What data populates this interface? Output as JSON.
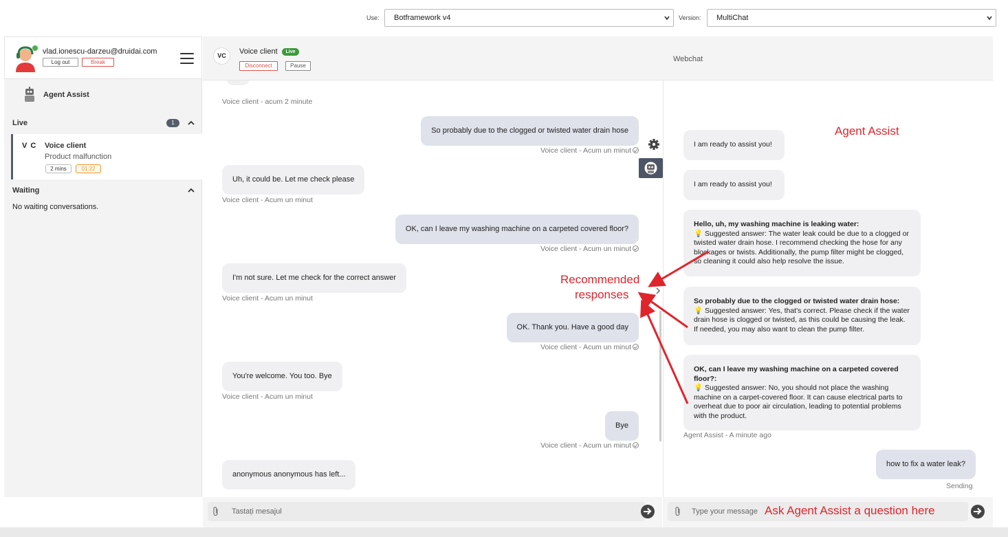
{
  "topbar": {
    "use_label": "Use:",
    "use_value": "Botframework v4",
    "version_label": "Version:",
    "version_value": "MultiChat"
  },
  "agent": {
    "email": "vlad.ionescu-darzeu@druidai.com",
    "logout_label": "Log out",
    "break_label": "Break"
  },
  "sidebar": {
    "agent_assist_label": "Agent Assist",
    "live_label": "Live",
    "live_count": "1",
    "conversation": {
      "initials": "V C",
      "title": "Voice client",
      "subtitle": "Product malfunction",
      "duration": "2 mins",
      "timer": "01:22"
    },
    "waiting_label": "Waiting",
    "no_waiting": "No waiting conversations."
  },
  "header": {
    "initials": "VC",
    "title": "Voice client",
    "live_badge": "Live",
    "disconnect_label": "Disconnect",
    "pause_label": "Pause",
    "webchat_title": "Webchat"
  },
  "chat": {
    "messages": [
      {
        "dir": "in",
        "text": "",
        "meta": "Voice client - acum 2 minute"
      },
      {
        "dir": "out",
        "text": "So probably due to the clogged or twisted water drain hose",
        "meta": "Voice client - Acum un minut"
      },
      {
        "dir": "in",
        "text": "Uh, it could be. Let me check please",
        "meta": "Voice client - Acum un minut"
      },
      {
        "dir": "out",
        "text": "OK, can I leave my washing machine on a carpeted covered floor?",
        "meta": "Voice client - Acum un minut"
      },
      {
        "dir": "in",
        "text": "I'm not sure. Let me check for the correct answer",
        "meta": "Voice client - Acum un minut"
      },
      {
        "dir": "out",
        "text": "OK. Thank you. Have a good day",
        "meta": "Voice client - Acum un minut"
      },
      {
        "dir": "in",
        "text": "You're welcome. You too. Bye",
        "meta": "Voice client - Acum un minut"
      },
      {
        "dir": "out",
        "text": "Bye",
        "meta": "Voice client - Acum un minut"
      },
      {
        "dir": "in",
        "text": "anonymous anonymous has left...",
        "meta": ""
      }
    ],
    "input_placeholder": "Tastați mesajul"
  },
  "assist": {
    "ready1": "I am ready to assist you!",
    "ready2": "I am ready to assist you!",
    "suggestions": [
      {
        "question": "Hello, uh, my washing machine is leaking water:",
        "answer": "Suggested answer: The water leak could be due to a clogged or twisted water drain hose. I recommend checking the hose for any blockages or twists. Additionally, the pump filter might be clogged, so cleaning it could also help resolve the issue."
      },
      {
        "question": "So probably due to the clogged or twisted water drain hose:",
        "answer": "Suggested answer: Yes, that's correct. Please check if the water drain hose is clogged or twisted, as this could be causing the leak. If needed, you may also want to clean the pump filter."
      },
      {
        "question": "OK, can I leave my washing machine on a carpeted covered floor?:",
        "answer": "Suggested answer: No, you should not place the washing machine on a carpet-covered floor. It can cause electrical parts to overheat due to poor air circulation, leading to potential problems with the product."
      }
    ],
    "meta": "Agent Assist - A minute ago",
    "user_question": "how to fix a water leak?",
    "sending": "Sending",
    "input_placeholder": "Type your message"
  },
  "annotations": {
    "agent_assist": "Agent Assist",
    "recommended_line1": "Recommended",
    "recommended_line2": "responses",
    "ask": "Ask Agent Assist a question here"
  },
  "colors": {
    "accent_dark": "#4d5566",
    "live_green": "#3c9a3c",
    "annotation_red": "#e0242c",
    "break_red": "#d9534f",
    "timer_orange": "#e8962c"
  }
}
